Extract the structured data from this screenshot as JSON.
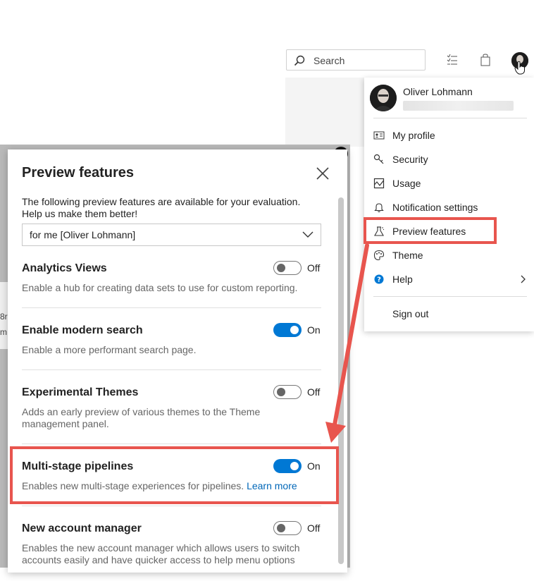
{
  "header": {
    "search_placeholder": "Search"
  },
  "background": {
    "side_text_1": "8r",
    "side_text_2": "m"
  },
  "panel": {
    "title": "Preview features",
    "description": "The following preview features are available for your evaluation. Help us make them better!",
    "scope_selected": "for me [Oliver Lohmann]",
    "features": [
      {
        "name": "Analytics Views",
        "description": "Enable a hub for creating data sets to use for custom reporting.",
        "state": "Off"
      },
      {
        "name": "Enable modern search",
        "description": "Enable a more performant search page.",
        "state": "On"
      },
      {
        "name": "Experimental Themes",
        "description": "Adds an early preview of various themes to the Theme management panel.",
        "state": "Off"
      },
      {
        "name": "Multi-stage pipelines",
        "description": "Enables new multi-stage experiences for pipelines.",
        "link": "Learn more",
        "state": "On"
      },
      {
        "name": "New account manager",
        "description": "Enables the new account manager which allows users to switch accounts easily and have quicker access to help menu options",
        "state": "Off"
      }
    ]
  },
  "profile_menu": {
    "name": "Oliver Lohmann",
    "items": [
      {
        "label": "My profile",
        "icon": "contact-card-icon"
      },
      {
        "label": "Security",
        "icon": "key-icon"
      },
      {
        "label": "Usage",
        "icon": "usage-icon"
      },
      {
        "label": "Notification settings",
        "icon": "bell-icon"
      },
      {
        "label": "Preview features",
        "icon": "flask-icon"
      },
      {
        "label": "Theme",
        "icon": "palette-icon"
      },
      {
        "label": "Help",
        "icon": "help-icon"
      }
    ],
    "sign_out": "Sign out"
  },
  "colors": {
    "accent": "#0078d4",
    "highlight": "#e8554e",
    "link": "#0067b8"
  }
}
